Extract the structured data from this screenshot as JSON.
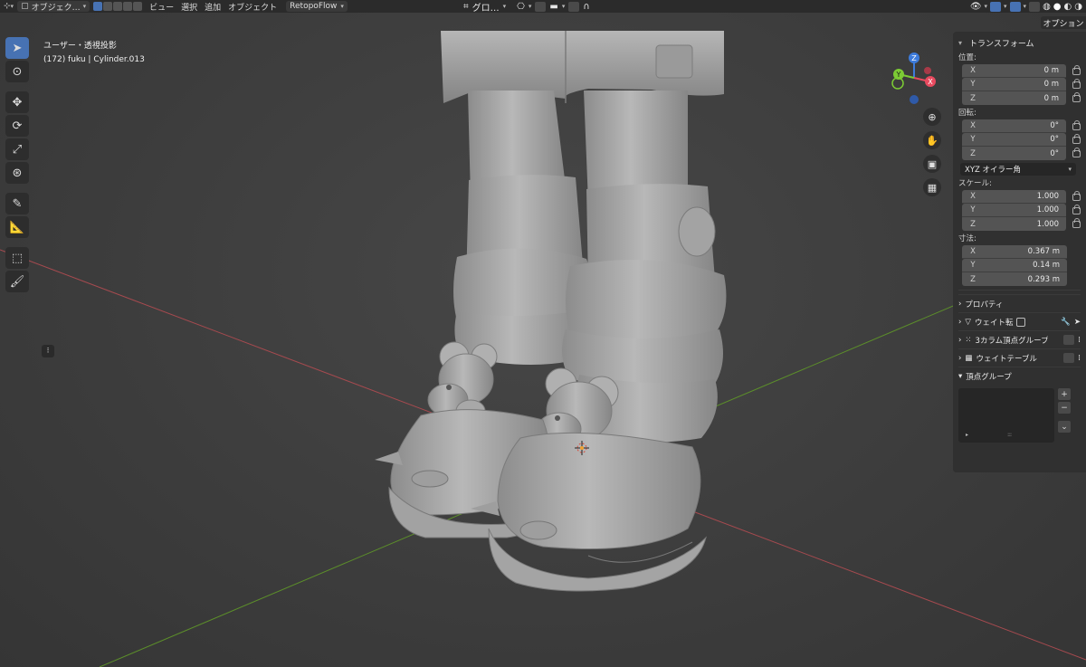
{
  "header": {
    "mode": "オブジェク…",
    "menu": [
      "ビュー",
      "選択",
      "追加",
      "オブジェクト"
    ],
    "addon": "RetopoFlow",
    "orientation": "グロ…",
    "options": "オプション"
  },
  "viewport": {
    "view_name": "ユーザー・透視投影",
    "object_info": "(172) fuku | Cylinder.013"
  },
  "gizmo": {
    "x": "X",
    "y": "Y",
    "z": "Z"
  },
  "toolbar": {
    "tools": [
      "select-tool",
      "cursor-tool",
      "move-tool",
      "rotate-tool",
      "scale-tool",
      "transform-tool",
      "annotate-tool",
      "measure-tool",
      "add-cube-tool",
      "paint-tool"
    ]
  },
  "sidebar": {
    "transform_title": "トランスフォーム",
    "location_label": "位置:",
    "location": [
      {
        "axis": "X",
        "value": "0 m"
      },
      {
        "axis": "Y",
        "value": "0 m"
      },
      {
        "axis": "Z",
        "value": "0 m"
      }
    ],
    "rotation_label": "回転:",
    "rotation": [
      {
        "axis": "X",
        "value": "0°"
      },
      {
        "axis": "Y",
        "value": "0°"
      },
      {
        "axis": "Z",
        "value": "0°"
      }
    ],
    "rotation_mode": "XYZ オイラー角",
    "scale_label": "スケール:",
    "scale": [
      {
        "axis": "X",
        "value": "1.000"
      },
      {
        "axis": "Y",
        "value": "1.000"
      },
      {
        "axis": "Z",
        "value": "1.000"
      }
    ],
    "dimensions_label": "寸法:",
    "dimensions": [
      {
        "axis": "X",
        "value": "0.367 m"
      },
      {
        "axis": "Y",
        "value": "0.14 m"
      },
      {
        "axis": "Z",
        "value": "0.293 m"
      }
    ],
    "properties": "プロパティ",
    "weight_transfer": "ウェイト転",
    "three_col": "3カラム頂点グループ",
    "weight_table": "ウェイトテーブル",
    "vertex_groups": "頂点グループ"
  },
  "colors": {
    "accent": "#4772b3",
    "x_axis": "#e84a5f",
    "y_axis": "#7ccc34",
    "z_axis": "#3d7bdb"
  }
}
